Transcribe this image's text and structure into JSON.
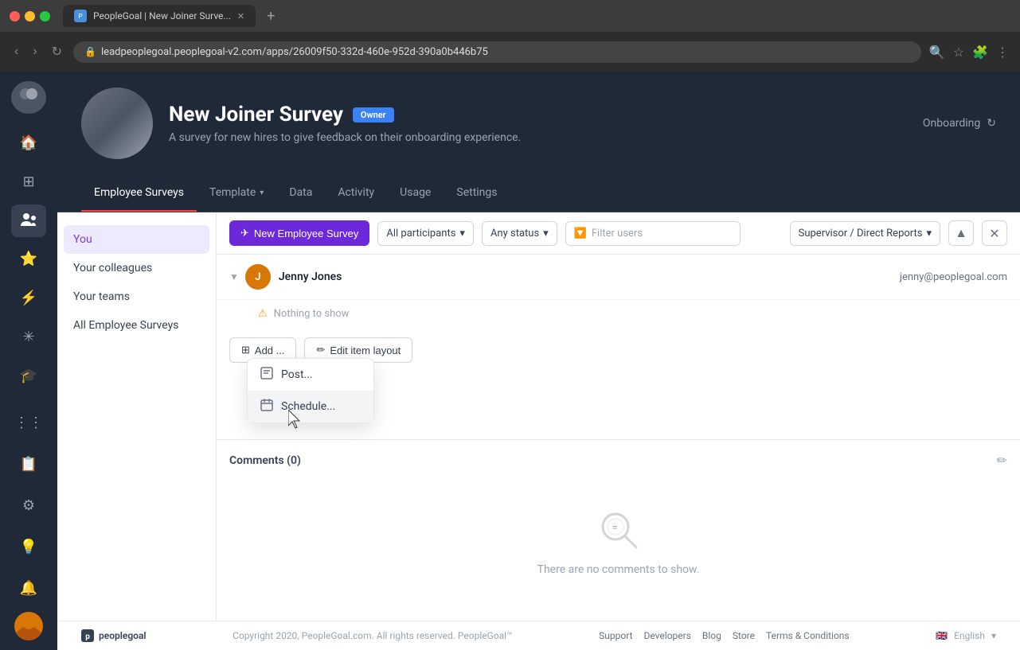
{
  "browser": {
    "tab_title": "PeopleGoal | New Joiner Surve...",
    "url": "leadpeoplegoal.peoplegoal-v2.com/apps/26009f50-332d-460e-952d-390a0b446b75",
    "new_tab_label": "+"
  },
  "header": {
    "title": "New Joiner Survey",
    "badge": "Owner",
    "description": "A survey for new hires to give feedback on their onboarding experience.",
    "onboarding_label": "Onboarding"
  },
  "nav": {
    "tabs": [
      {
        "label": "Employee Surveys",
        "active": true
      },
      {
        "label": "Template",
        "has_chevron": true
      },
      {
        "label": "Data"
      },
      {
        "label": "Activity"
      },
      {
        "label": "Usage"
      },
      {
        "label": "Settings"
      }
    ]
  },
  "sidebar": {
    "items": [
      {
        "icon": "🏠",
        "name": "home"
      },
      {
        "icon": "⊞",
        "name": "dashboard"
      },
      {
        "icon": "👤",
        "name": "profile",
        "active": true
      },
      {
        "icon": "⭐",
        "name": "star"
      },
      {
        "icon": "✦",
        "name": "goals"
      },
      {
        "icon": "❋",
        "name": "feedback"
      },
      {
        "icon": "🎓",
        "name": "learning"
      },
      {
        "icon": "⚙",
        "name": "org-chart"
      },
      {
        "icon": "📋",
        "name": "table"
      },
      {
        "icon": "⚙",
        "name": "settings"
      }
    ]
  },
  "left_panel": {
    "items": [
      {
        "label": "You",
        "active": true
      },
      {
        "label": "Your colleagues"
      },
      {
        "label": "Your teams"
      },
      {
        "label": "All Employee Surveys"
      }
    ]
  },
  "toolbar": {
    "new_survey_btn": "New Employee Survey",
    "participants_options": [
      "All participants"
    ],
    "status_options": [
      "Any status"
    ],
    "filter_placeholder": "Filter users",
    "supervisor_label": "Supervisor / Direct Reports"
  },
  "table": {
    "user": {
      "name": "Jenny Jones",
      "email": "jenny@peoplegoal.com",
      "nothing_to_show": "Nothing to show"
    }
  },
  "action_buttons": {
    "add_label": "Add ...",
    "edit_label": "Edit item layout"
  },
  "dropdown": {
    "items": [
      {
        "label": "Post...",
        "icon": "📤"
      },
      {
        "label": "Schedule...",
        "icon": "📅"
      }
    ]
  },
  "comments": {
    "title": "Comments (0)",
    "empty_text": "There are no comments to show."
  },
  "footer": {
    "logo": "peoplegoal",
    "copyright": "Copyright 2020, PeopleGoal.com. All rights reserved. PeopleGoal™",
    "links": [
      "Support",
      "Developers",
      "Blog",
      "Store",
      "Terms & Conditions"
    ],
    "language": "English"
  }
}
